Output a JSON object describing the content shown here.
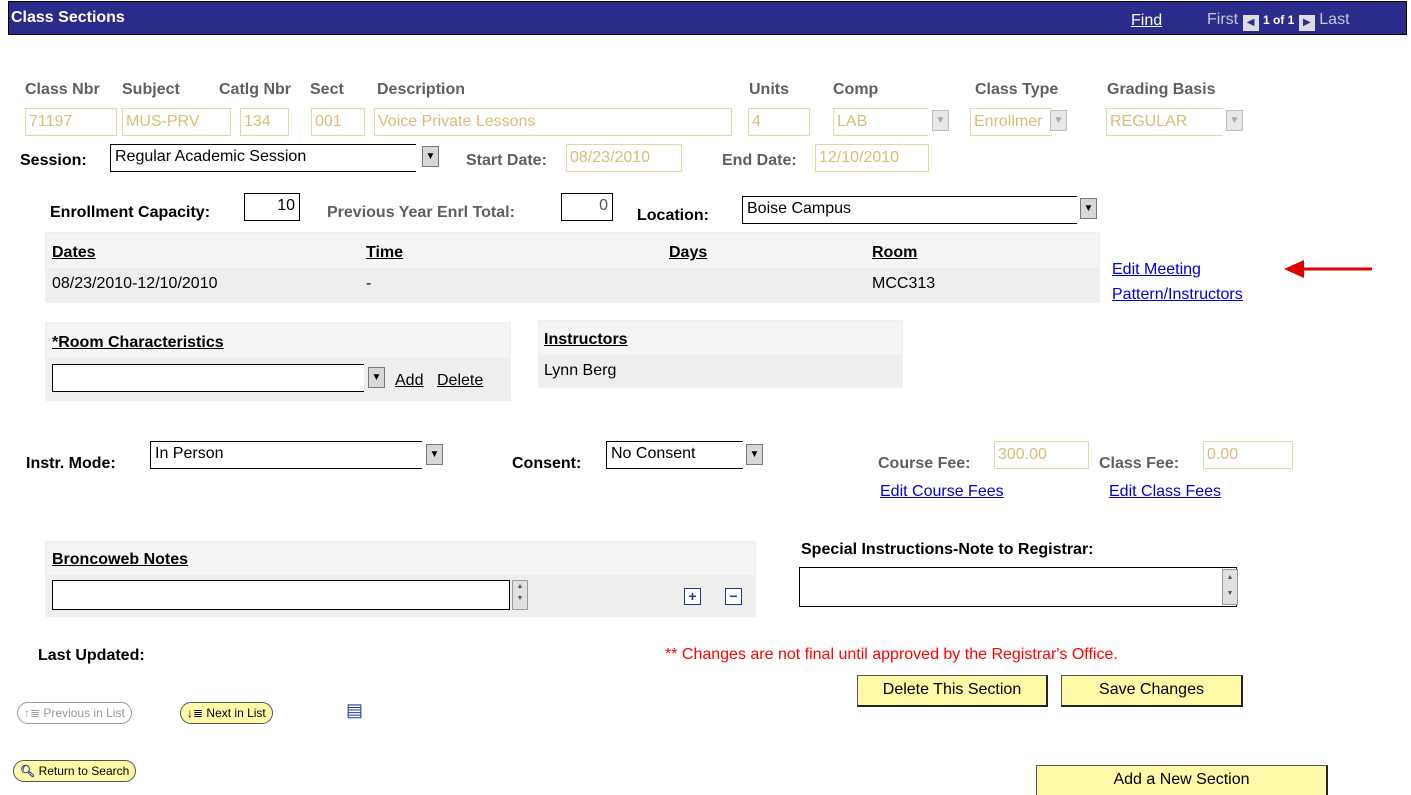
{
  "header": {
    "title": "Class Sections",
    "find_label": "Find",
    "first_label": "First",
    "count_label": "1 of 1",
    "last_label": "Last"
  },
  "fields": {
    "class_nbr": {
      "label": "Class Nbr",
      "value": "71197"
    },
    "subject": {
      "label": "Subject",
      "value": "MUS-PRV"
    },
    "catlg_nbr": {
      "label": "Catlg Nbr",
      "value": "134"
    },
    "sect": {
      "label": "Sect",
      "value": "001"
    },
    "description": {
      "label": "Description",
      "value": "Voice Private Lessons"
    },
    "units": {
      "label": "Units",
      "value": "4"
    },
    "comp": {
      "label": "Comp",
      "value": "LAB"
    },
    "class_type": {
      "label": "Class Type",
      "value": "Enrollmer"
    },
    "grading_basis": {
      "label": "Grading Basis",
      "value": "REGULAR"
    }
  },
  "session": {
    "label": "Session:",
    "value": "Regular Academic Session"
  },
  "start_date": {
    "label": "Start Date:",
    "value": "08/23/2010"
  },
  "end_date": {
    "label": "End Date:",
    "value": "12/10/2010"
  },
  "enrollment": {
    "label": "Enrollment Capacity:",
    "value": "10"
  },
  "prev_year": {
    "label": "Previous Year Enrl Total:",
    "value": "0"
  },
  "location": {
    "label": "Location:",
    "value": "Boise Campus"
  },
  "meeting": {
    "headers": {
      "dates": "Dates",
      "time": "Time",
      "days": "Days",
      "room": "Room"
    },
    "row": {
      "dates": "08/23/2010-12/10/2010",
      "time": "-",
      "days": "",
      "room": "MCC313"
    },
    "edit_link_line1": "Edit Meeting",
    "edit_link_line2": "Pattern/Instructors"
  },
  "room_char": {
    "title": "*Room Characteristics",
    "add_label": "Add",
    "delete_label": "Delete"
  },
  "instructors": {
    "title": "Instructors",
    "name": "Lynn Berg"
  },
  "instr_mode": {
    "label": "Instr. Mode:",
    "value": "In Person"
  },
  "consent": {
    "label": "Consent:",
    "value": "No Consent"
  },
  "course_fee": {
    "label": "Course Fee:",
    "value": "300.00",
    "link": "Edit Course Fees"
  },
  "class_fee": {
    "label": "Class Fee:",
    "value": "0.00",
    "link": "Edit Class Fees"
  },
  "notes": {
    "title": "Broncoweb Notes"
  },
  "special": {
    "label": "Special Instructions-Note to Registrar:"
  },
  "last_updated": {
    "label": "Last Updated:"
  },
  "notice": "** Changes are not final until approved by the Registrar's Office.",
  "buttons": {
    "delete_section": "Delete This Section",
    "save_changes": "Save Changes",
    "add_section": "Add a New Section",
    "prev_in_list": "Previous in List",
    "next_in_list": "Next in List",
    "return_to_search": "Return to Search"
  },
  "colors": {
    "title_bar": "#2b2b8c",
    "link": "#0000cc",
    "button": "#fff9a8",
    "notice": "#ff0000",
    "arrow": "#e00000"
  }
}
